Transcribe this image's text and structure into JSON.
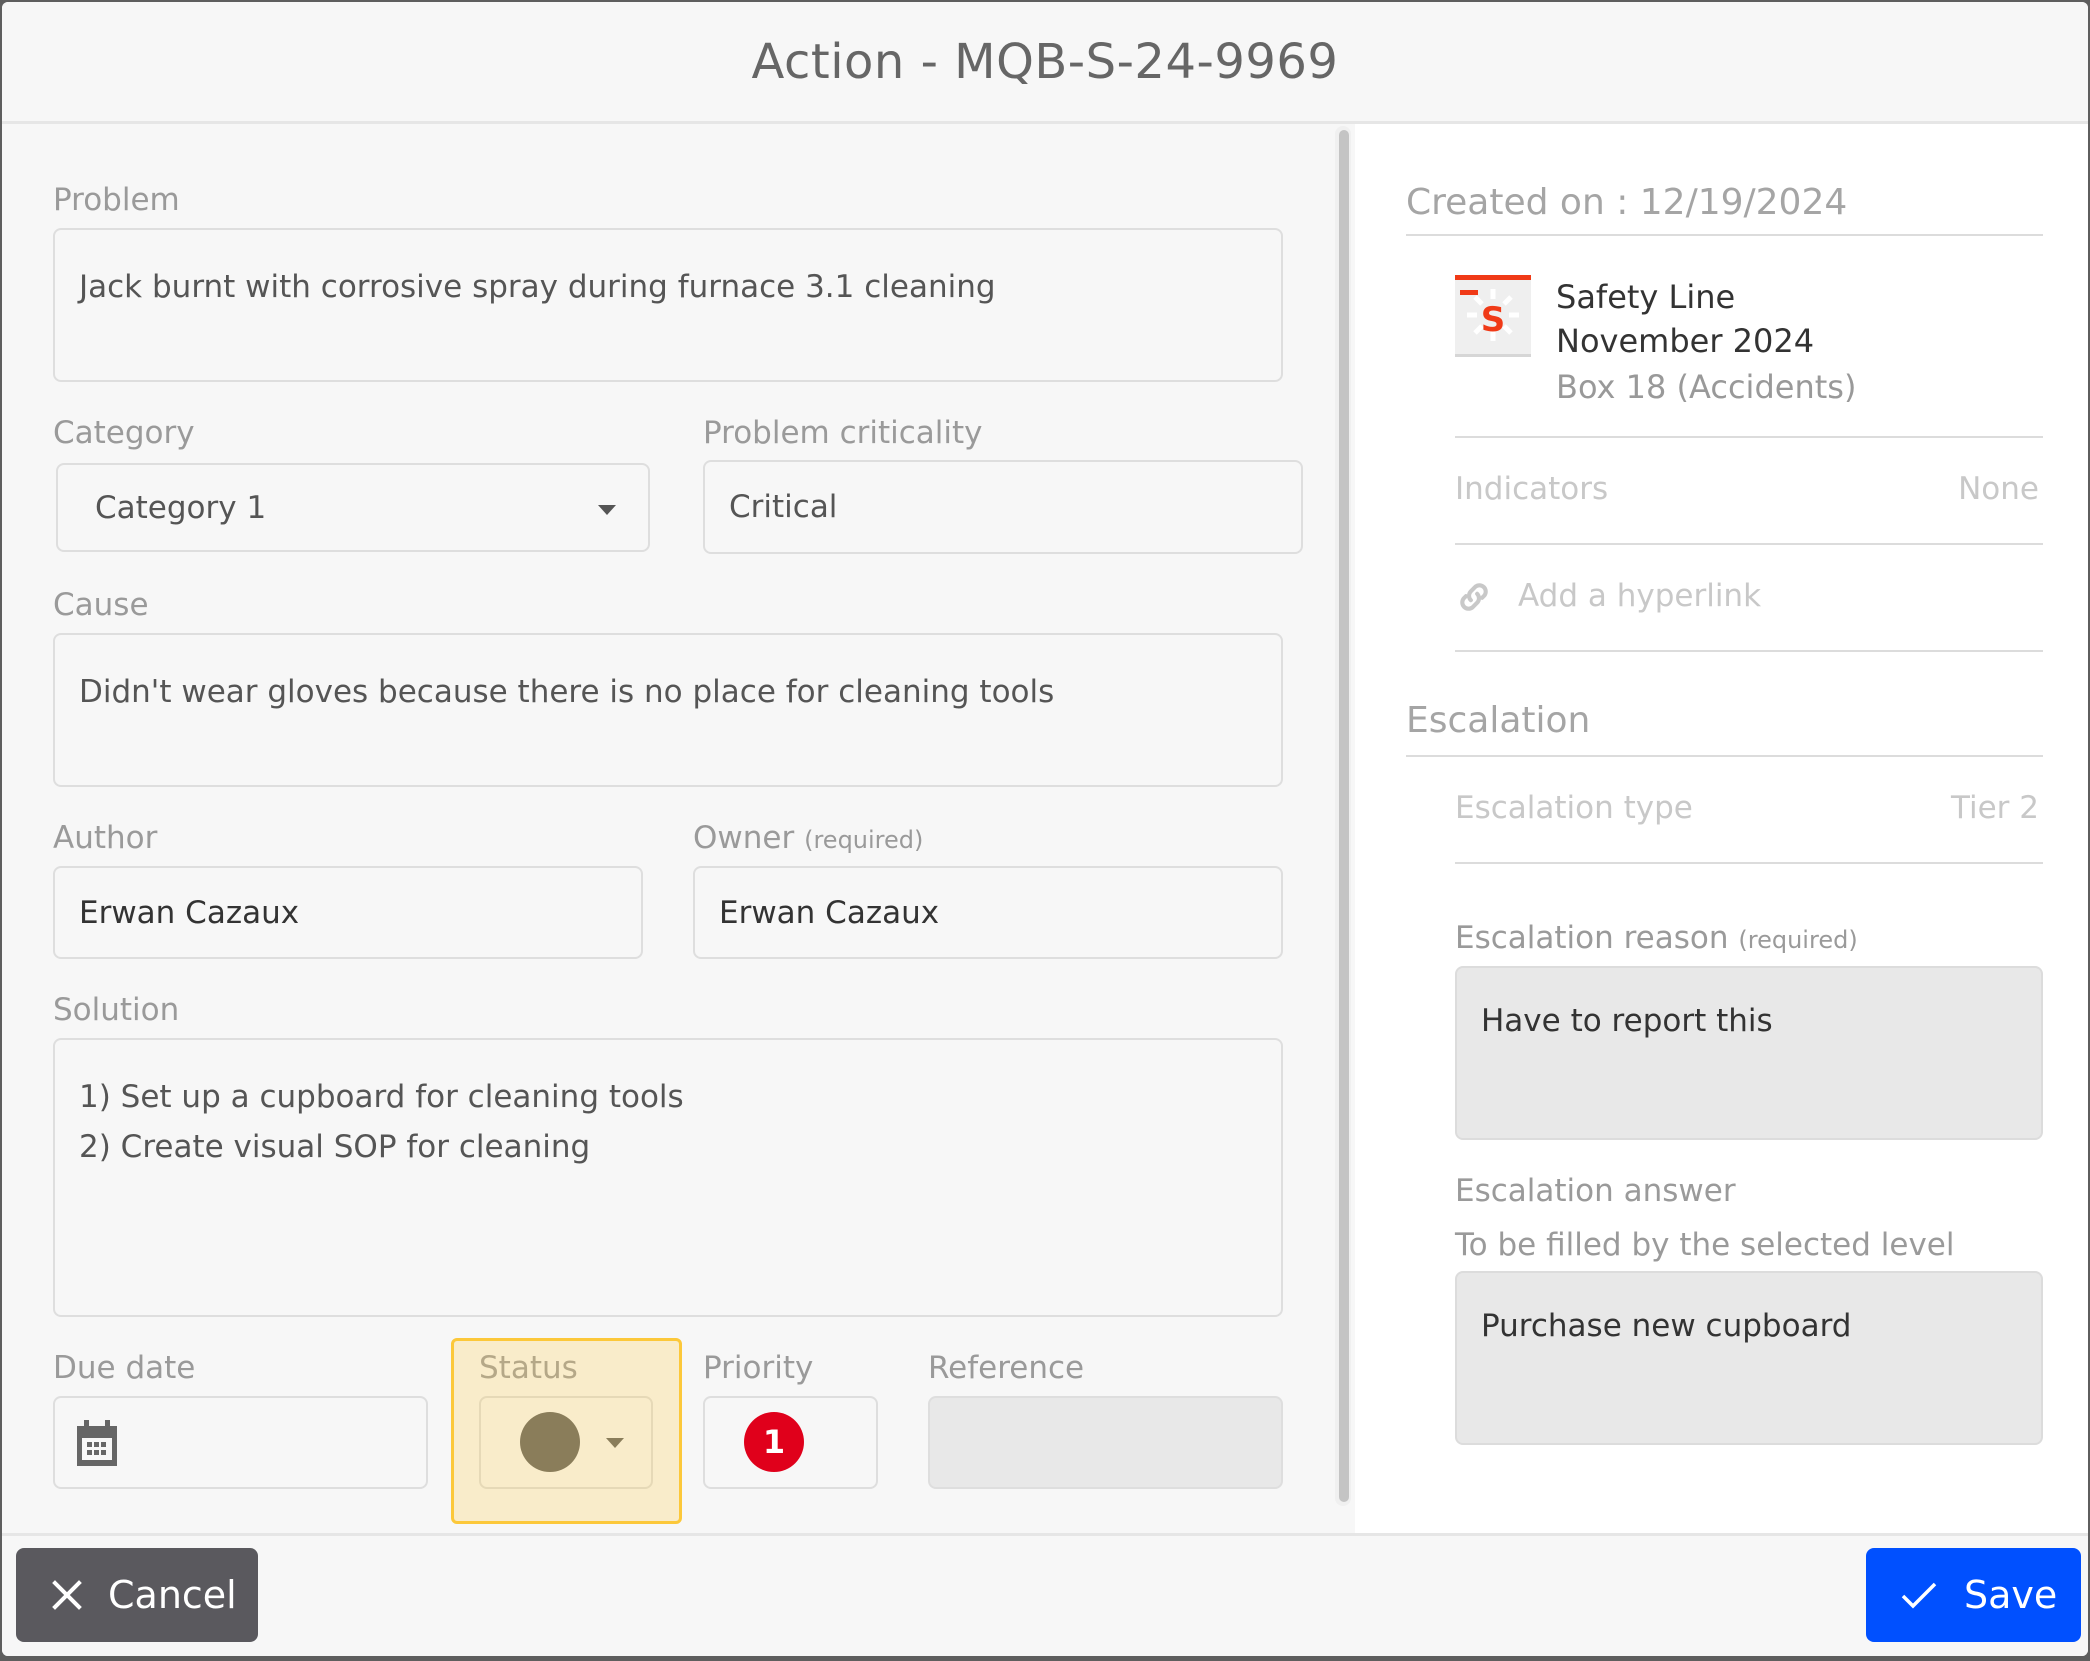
{
  "dialog": {
    "title": "Action - MQB-S-24-9969"
  },
  "form": {
    "problem": {
      "label": "Problem",
      "value": "Jack burnt with corrosive spray during furnace 3.1 cleaning"
    },
    "category": {
      "label": "Category",
      "value": "Category 1"
    },
    "criticality": {
      "label": "Problem criticality",
      "value": "Critical"
    },
    "cause": {
      "label": "Cause",
      "value": "Didn't wear gloves because there is no place for cleaning tools"
    },
    "author": {
      "label": "Author",
      "value": "Erwan Cazaux"
    },
    "owner": {
      "label": "Owner",
      "required": "(required)",
      "value": "Erwan Cazaux"
    },
    "solution": {
      "label": "Solution",
      "lines": [
        "1) Set up a cupboard for cleaning tools",
        "2) Create visual SOP for cleaning"
      ]
    },
    "due_date": {
      "label": "Due date",
      "value": "",
      "icon": "calendar-icon"
    },
    "status": {
      "label": "Status",
      "color": "#8a7d5a"
    },
    "priority": {
      "label": "Priority",
      "value": "1",
      "color": "#e0001b"
    },
    "reference": {
      "label": "Reference",
      "value": ""
    }
  },
  "details": {
    "created_on": "Created on : 12/19/2024",
    "board": {
      "icon": "safety-line-icon",
      "icon_letter": "S",
      "name": "Safety Line",
      "period": "November 2024",
      "box": "Box 18 (Accidents)"
    },
    "indicators": {
      "label": "Indicators",
      "value": "None"
    },
    "hyperlink": {
      "label": "Add a hyperlink",
      "icon": "link-icon"
    },
    "escalation": {
      "heading": "Escalation",
      "type_label": "Escalation type",
      "type_value": "Tier 2",
      "reason_label": "Escalation reason",
      "reason_required": "(required)",
      "reason_value": "Have to report this",
      "answer_label": "Escalation answer",
      "answer_hint": "To be filled by the selected level",
      "answer_value": "Purchase new cupboard"
    }
  },
  "footer": {
    "cancel_label": "Cancel",
    "save_label": "Save",
    "save_color": "#0050ff"
  }
}
